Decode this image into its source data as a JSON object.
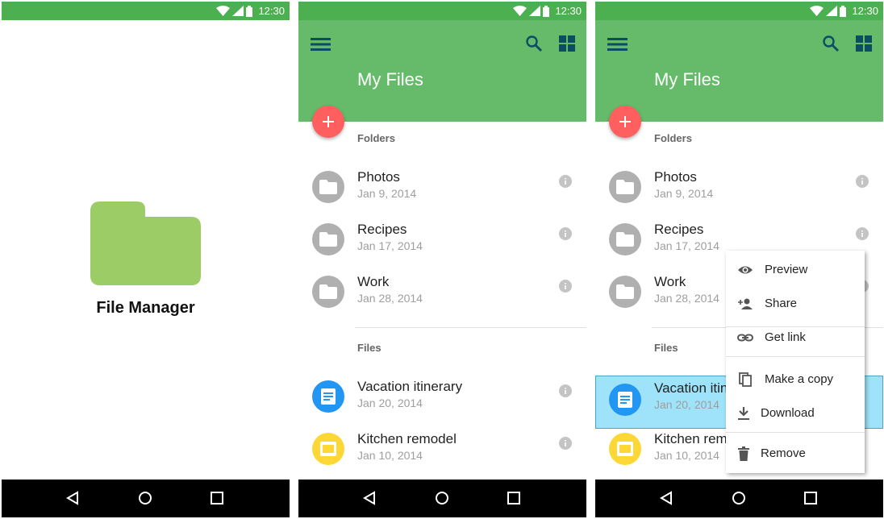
{
  "status_bar": {
    "time": "12:30"
  },
  "splash": {
    "title": "File Manager"
  },
  "app": {
    "title": "My Files",
    "sections": {
      "folders": "Folders",
      "files": "Files"
    },
    "folders": [
      {
        "name": "Photos",
        "date": "Jan 9, 2014"
      },
      {
        "name": "Recipes",
        "date": "Jan 17, 2014"
      },
      {
        "name": "Work",
        "date": "Jan 28, 2014"
      }
    ],
    "files": [
      {
        "name": "Vacation itinerary",
        "date": "Jan 20, 2014",
        "icon": "document-icon",
        "color": "#2196f3"
      },
      {
        "name": "Kitchen remodel",
        "date": "Jan 10, 2014",
        "icon": "slides-icon",
        "color": "#fdd835"
      }
    ],
    "files_truncated": [
      {
        "name": "Vacation itin",
        "date": "Jan 20, 2014"
      },
      {
        "name": "Kitchen rem",
        "date": "Jan 10, 2014"
      }
    ]
  },
  "context_menu": {
    "items": [
      {
        "label": "Preview",
        "icon": "eye-icon"
      },
      {
        "label": "Share",
        "icon": "person-add-icon"
      },
      {
        "label": "Get link",
        "icon": "link-icon"
      },
      {
        "label": "Make a copy",
        "icon": "copy-icon"
      },
      {
        "label": "Download",
        "icon": "download-icon"
      },
      {
        "label": "Remove",
        "icon": "trash-icon"
      }
    ]
  },
  "colors": {
    "status_bar": "#4caf50",
    "app_bar": "#66bb6a",
    "fab": "#ff5f5f",
    "folder_splash": "#9ccc65",
    "folder_circle": "#b0b0b0",
    "selected_row": "#9ee3f9"
  }
}
